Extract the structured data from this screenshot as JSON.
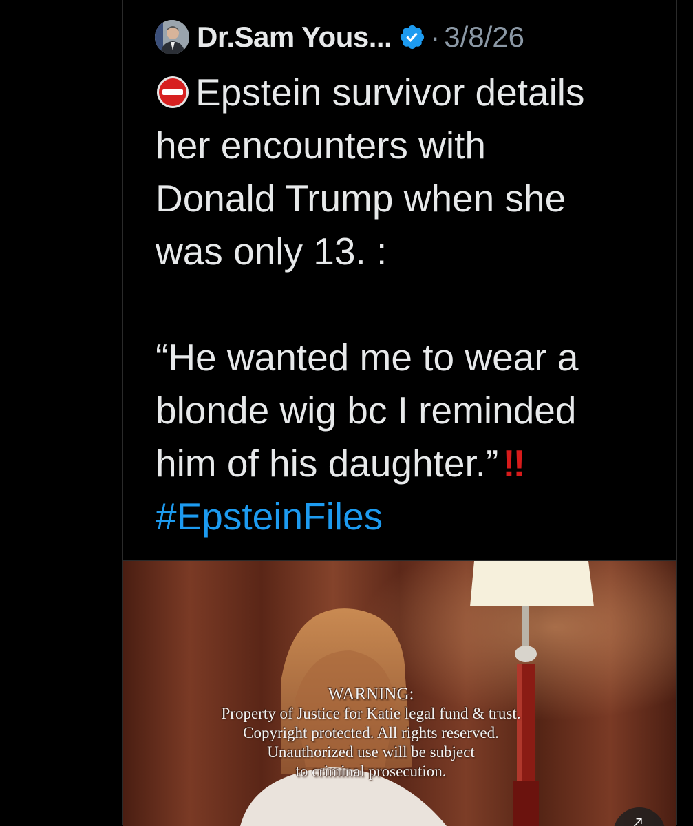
{
  "tweet": {
    "author_name": "Dr.Sam Yous...",
    "separator": "·",
    "date": "3/8/26",
    "verified_icon": "verified-badge-icon",
    "avatar_icon": "avatar",
    "lines": [
      "Epstein survivor details",
      "her encounters with",
      "Donald Trump when she",
      "was only 13. :",
      "“He wanted me to wear a",
      "blonde wig bc I reminded",
      "him of his daughter.”"
    ],
    "emphasis": "‼",
    "hashtag": "#EpsteinFiles"
  },
  "media": {
    "warning_title": "WARNING:",
    "warning_lines": [
      "Property of Justice for Katie legal fund & trust.",
      "Copyright protected. All rights reserved.",
      "Unauthorized use will be subject",
      "to criminal prosecution."
    ],
    "expand_icon": "expand-icon"
  },
  "colors": {
    "background": "#000000",
    "text": "#e7e9ea",
    "muted": "#8b98a5",
    "link": "#1d9bf0",
    "verified": "#1d9bf0",
    "alert_red": "#d71b1b"
  }
}
